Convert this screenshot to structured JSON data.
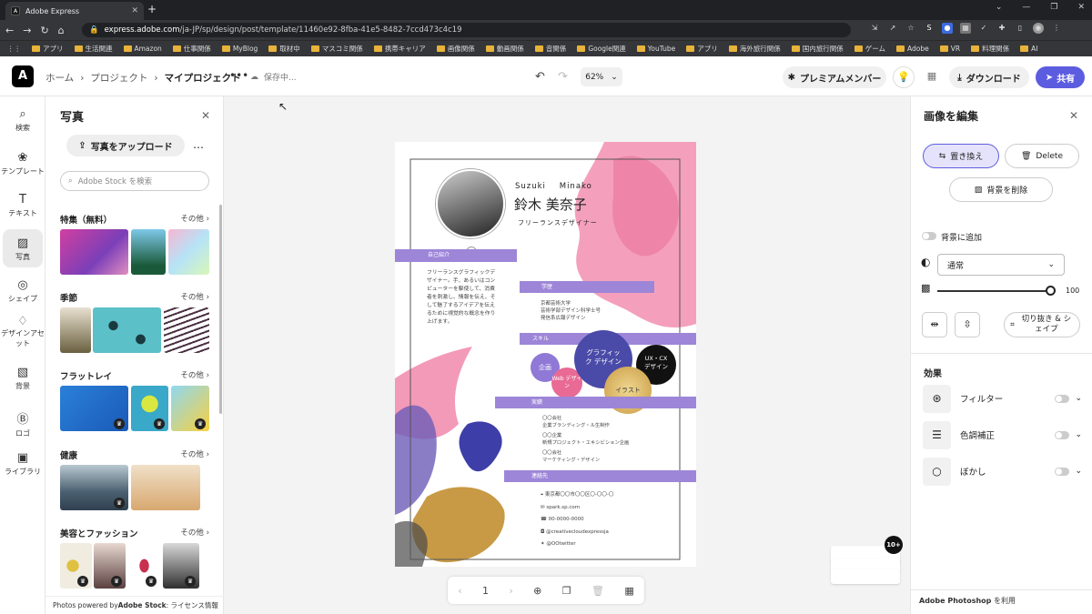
{
  "browser": {
    "tab_title": "Adobe Express",
    "url_host": "express.adobe.com",
    "url_path": "/ja-JP/sp/design/post/template/11460e92-8fba-41e5-8482-7ccd473c4c19",
    "bookmarks": [
      "アプリ",
      "生活関連",
      "Amazon",
      "仕事関係",
      "MyBlog",
      "取材中",
      "マスコミ関係",
      "携帯キャリア",
      "画像関係",
      "動画関係",
      "音関係",
      "Google関連",
      "YouTube",
      "アプリ",
      "海外旅行関係",
      "国内旅行関係",
      "ゲーム",
      "Adobe",
      "VR",
      "料理関係",
      "AI"
    ]
  },
  "header": {
    "crumbs": [
      "ホーム",
      "プロジェクト",
      "マイプロジェクト"
    ],
    "saving": "保存中...",
    "zoom": "62%",
    "premium": "プレミアムメンバー",
    "download": "ダウンロード",
    "share": "共有"
  },
  "rail": [
    "検索",
    "テンプレート",
    "テキスト",
    "写真",
    "シェイプ",
    "デザインアセット",
    "背景",
    "ロゴ",
    "ライブラリ"
  ],
  "photos": {
    "title": "写真",
    "upload": "写真をアップロード",
    "search_placeholder": "Adobe Stock を検索",
    "more": "その他",
    "sections": [
      "特集（無料）",
      "季節",
      "フラットレイ",
      "健康",
      "美容とファッション"
    ],
    "credit_prefix": "Photos powered by ",
    "credit_brand": "Adobe Stock",
    "credit_suffix": " : ライセンス情報"
  },
  "resume": {
    "name_en_first": "Suzuki",
    "name_en_last": "Minako",
    "name_jp": "鈴木 美奈子",
    "title": "フリーランスデザイナー",
    "sec_intro": "自己紹介",
    "intro": "フリーランスグラフィックデザイナー。手、あるいはコンピューターを駆使して、消費者を刺激し、情報を伝え、そして魅了するアイデアを伝えるために視覚的な概念を作り上げます。",
    "sec_edu": "学歴",
    "edu": [
      "京都芸術大学",
      "芸術学部デザイン科学士号",
      "発信系広報デザイン"
    ],
    "sec_skill": "スキル",
    "skills": [
      "企画",
      "Web デザイン",
      "グラフィック デザイン",
      "UX・CX デザイン",
      "イラスト"
    ],
    "sec_work": "実績",
    "work": [
      "〇〇会社",
      "企業ブランディング・ル生制作",
      "〇〇企業",
      "新規プロジェクト・エキシビション企画",
      "〇〇会社",
      "マーケティング・デザイン"
    ],
    "sec_contact": "連絡先",
    "contact": [
      "東京都〇〇市〇〇区〇-〇〇-〇",
      "spark.sp.com",
      "00-0000-0000",
      "@creativecloudexpressja",
      "@OOtwitter"
    ]
  },
  "pager": {
    "page": "1"
  },
  "stack_badge": "10+",
  "edit": {
    "title": "画像を編集",
    "replace": "置き換え",
    "delete": "Delete",
    "remove_bg": "背景を削除",
    "bg_add": "背景に追加",
    "blend": "通常",
    "opacity": "100",
    "crop": "切り抜き & シェイプ",
    "effects": "効果",
    "filter": "フィルター",
    "tone": "色調補正",
    "blur": "ぼかし",
    "ps_brand": "Adobe Photoshop",
    "ps_suffix": " を利用"
  }
}
